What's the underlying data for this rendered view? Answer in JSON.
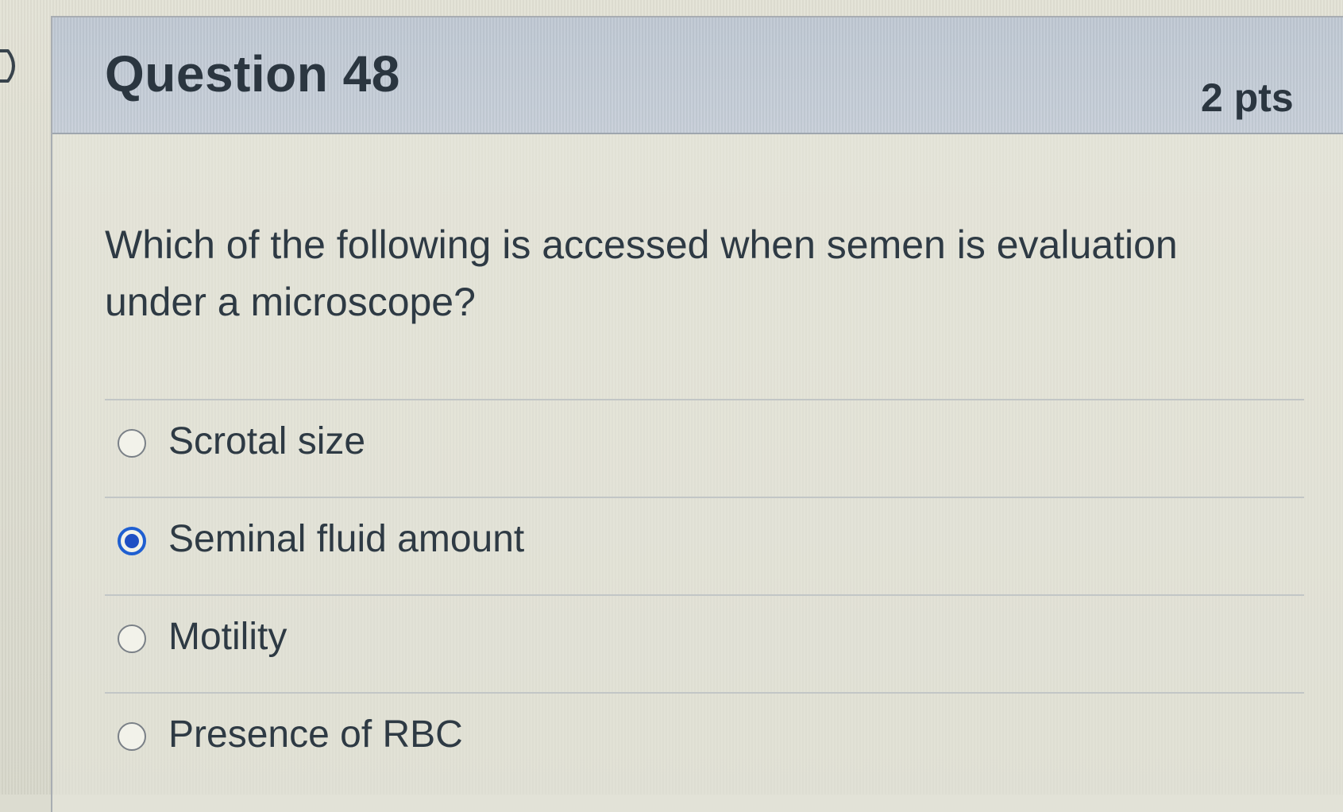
{
  "question": {
    "title": "Question 48",
    "points": "2 pts",
    "text": "Which of the following is accessed when semen is evaluation under a microscope?"
  },
  "answers": [
    {
      "label": "Scrotal size",
      "selected": false
    },
    {
      "label": "Seminal fluid amount",
      "selected": true
    },
    {
      "label": "Motility",
      "selected": false
    },
    {
      "label": "Presence of RBC",
      "selected": false
    }
  ],
  "colors": {
    "header_bg": "#c2cbd6",
    "page_bg": "#dcdcd0",
    "radio_selected": "#1f4fc4",
    "text": "#2e3a44"
  },
  "icons": {
    "collapse": "chevron-right-icon"
  }
}
